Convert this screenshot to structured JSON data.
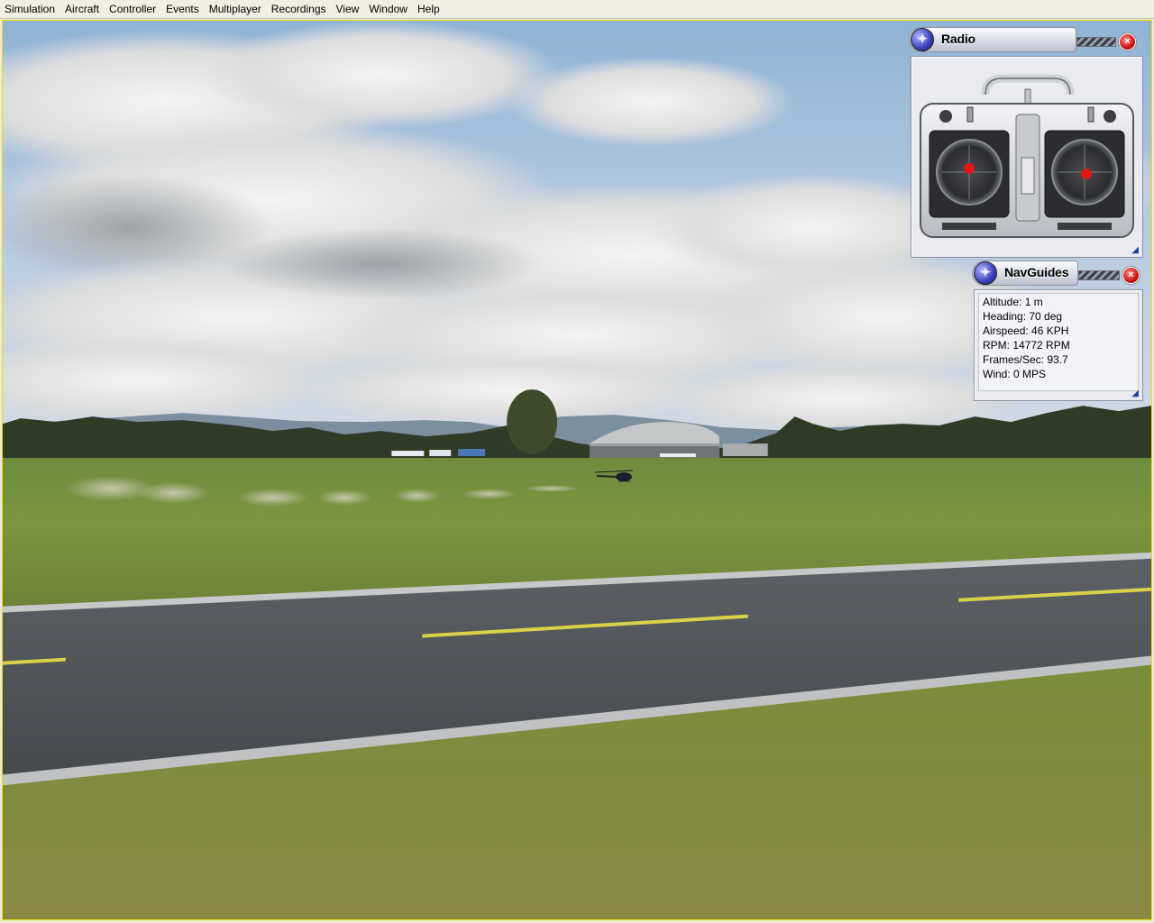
{
  "menu": {
    "items": [
      "Simulation",
      "Aircraft",
      "Controller",
      "Events",
      "Multiplayer",
      "Recordings",
      "View",
      "Window",
      "Help"
    ]
  },
  "radio_panel": {
    "title": "Radio",
    "close_icon": "close-icon",
    "logo_icon": "propeller-logo-icon",
    "left_stick": "left-gimbal-stick",
    "right_stick": "right-gimbal-stick"
  },
  "nav_panel": {
    "title": "NavGuides",
    "close_icon": "close-icon",
    "lines": [
      "Altitude: 1 m",
      "Heading: 70 deg",
      "Airspeed: 46 KPH",
      "RPM: 14772 RPM",
      "Frames/Sec: 93.7",
      "Wind: 0 MPS"
    ]
  },
  "colors": {
    "accent_red": "#c8160f",
    "logo_blue": "#3a3fb8",
    "panel_bg": "#e9ebf1",
    "viewport_border": "#f0e000"
  }
}
